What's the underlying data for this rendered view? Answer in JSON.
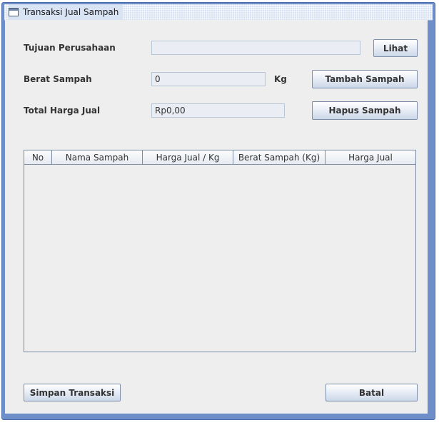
{
  "window": {
    "title": "Transaksi Jual Sampah",
    "icon": "window-icon"
  },
  "form": {
    "tujuan_label": "Tujuan Perusahaan",
    "tujuan_value": "",
    "berat_label": "Berat Sampah",
    "berat_value": "0",
    "berat_unit": "Kg",
    "total_label": "Total Harga Jual",
    "total_value": "Rp0,00"
  },
  "buttons": {
    "lihat": "Lihat",
    "tambah": "Tambah Sampah",
    "hapus": "Hapus Sampah",
    "simpan": "Simpan Transaksi",
    "batal": "Batal"
  },
  "table": {
    "columns": [
      "No",
      "Nama Sampah",
      "Harga Jual / Kg",
      "Berat Sampah (Kg)",
      "Harga Jual"
    ],
    "rows": []
  },
  "colors": {
    "frame": "#6d8ec9",
    "background": "#eeeeee",
    "button_border": "#7d8fa8"
  }
}
